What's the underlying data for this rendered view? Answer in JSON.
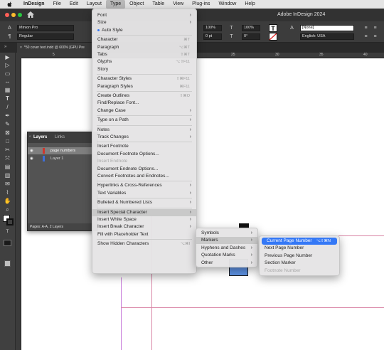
{
  "menubar": {
    "items": [
      "InDesign",
      "File",
      "Edit",
      "Layout",
      "Type",
      "Object",
      "Table",
      "View",
      "Plug-ins",
      "Window",
      "Help"
    ],
    "active": "Type"
  },
  "window": {
    "title": "Adobe InDesign 2024"
  },
  "control": {
    "font_family": "Minion Pro",
    "font_style": "Regular",
    "zoom_a": "100%",
    "zoom_b": "100%",
    "tracking": "0 pt",
    "angle": "0°",
    "paragraph_style": "[None]",
    "language": "English: USA"
  },
  "document_tab": "*50 cover text.indd @ 600% [GPU Pre",
  "ruler_ticks": [
    "5",
    "25",
    "30",
    "35",
    "40"
  ],
  "layers_panel": {
    "tabs": [
      "Layers",
      "Links"
    ],
    "rows": [
      {
        "name": "page numbers",
        "color": "#d0352b"
      },
      {
        "name": "Layer 1",
        "color": "#3d6fd9"
      }
    ],
    "footer": "Pages: A-A, 2 Layers"
  },
  "type_menu": [
    {
      "label": "Font",
      "arrow": true
    },
    {
      "label": "Size",
      "arrow": true
    },
    {
      "label": "Auto Style",
      "dot": true
    },
    {
      "sep": true
    },
    {
      "label": "Character",
      "shortcut": "⌘T"
    },
    {
      "label": "Paragraph",
      "shortcut": "⌥⌘T"
    },
    {
      "label": "Tabs",
      "shortcut": "⇧⌘T"
    },
    {
      "label": "Glyphs",
      "shortcut": "⌥⇧F11"
    },
    {
      "label": "Story"
    },
    {
      "sep": true
    },
    {
      "label": "Character Styles",
      "shortcut": "⇧⌘F11"
    },
    {
      "label": "Paragraph Styles",
      "shortcut": "⌘F11"
    },
    {
      "sep": true
    },
    {
      "label": "Create Outlines",
      "shortcut": "⇧⌘O"
    },
    {
      "label": "Find/Replace Font..."
    },
    {
      "label": "Change Case",
      "arrow": true
    },
    {
      "sep": true
    },
    {
      "label": "Type on a Path",
      "arrow": true
    },
    {
      "sep": true
    },
    {
      "label": "Notes",
      "arrow": true
    },
    {
      "label": "Track Changes",
      "arrow": true
    },
    {
      "sep": true
    },
    {
      "label": "Insert Footnote"
    },
    {
      "label": "Document Footnote Options..."
    },
    {
      "label": "Insert Endnote",
      "disabled": true
    },
    {
      "label": "Document Endnote Options..."
    },
    {
      "label": "Convert Footnotes and Endnotes..."
    },
    {
      "sep": true
    },
    {
      "label": "Hyperlinks & Cross-References",
      "arrow": true
    },
    {
      "label": "Text Variables",
      "arrow": true
    },
    {
      "sep": true
    },
    {
      "label": "Bulleted & Numbered Lists",
      "arrow": true
    },
    {
      "sep": true
    },
    {
      "label": "Insert Special Character",
      "arrow": true,
      "selected": true
    },
    {
      "label": "Insert White Space",
      "arrow": true
    },
    {
      "label": "Insert Break Character",
      "arrow": true
    },
    {
      "label": "Fill with Placeholder Text"
    },
    {
      "sep": true
    },
    {
      "label": "Show Hidden Characters",
      "shortcut": "⌥⌘I"
    }
  ],
  "special_char_menu": [
    {
      "label": "Symbols",
      "arrow": true
    },
    {
      "label": "Markers",
      "arrow": true,
      "selected": true
    },
    {
      "label": "Hyphens and Dashes",
      "arrow": true
    },
    {
      "label": "Quotation Marks",
      "arrow": true
    },
    {
      "label": "Other",
      "arrow": true
    }
  ],
  "markers_menu": [
    {
      "label": "Current Page Number",
      "shortcut": "⌥⇧⌘N",
      "highlighted": true
    },
    {
      "label": "Next Page Number"
    },
    {
      "label": "Previous Page Number"
    },
    {
      "label": "Section Marker"
    },
    {
      "label": "Footnote Number",
      "disabled": true
    }
  ],
  "colors": {
    "accent": "#3478f6",
    "guide": "#d985a6"
  }
}
